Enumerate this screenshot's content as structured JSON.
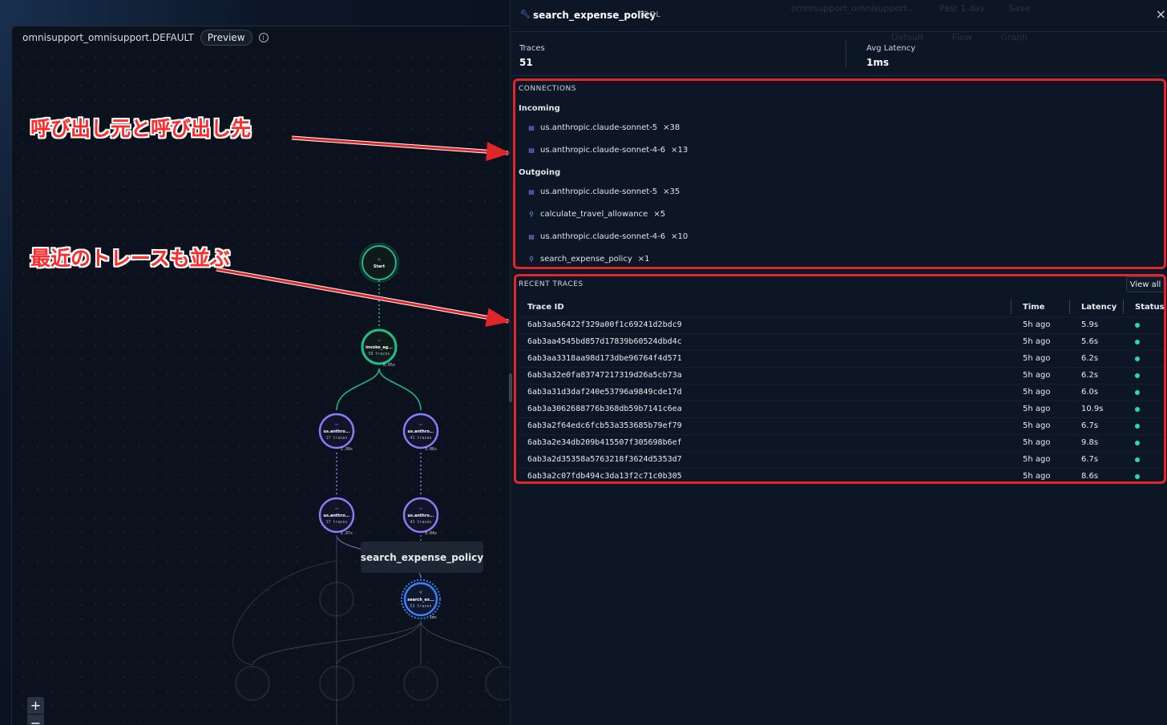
{
  "graph": {
    "title": "omnisupport_omnisupport.DEFAULT",
    "preview_label": "Preview",
    "nodes": {
      "start": "Start",
      "invoke": {
        "label": "invoke_ag...",
        "traces": "58 traces",
        "latency": "8.05s"
      },
      "l1a": {
        "label": "us.anthro...",
        "traces": "17 traces",
        "latency": "1.99s"
      },
      "l1b": {
        "label": "us.anthro...",
        "traces": "41 traces",
        "latency": "3.06s"
      },
      "l2a": {
        "label": "us.anthro...",
        "traces": "17 traces",
        "latency": "1.97s"
      },
      "l2b": {
        "label": "us.anthro...",
        "traces": "41 traces",
        "latency": "3.04s"
      },
      "search": {
        "label": "search_ex...",
        "traces": "51 traces",
        "latency": "1ms"
      }
    },
    "tooltip": "search_expense_policy",
    "zoom_in": "+",
    "zoom_out": "−"
  },
  "annotations": {
    "note1": "呼び出し元と呼び出し先",
    "note2": "最近のトレースも並ぶ"
  },
  "panel": {
    "title": "search_expense_policy",
    "badge": "TOOL",
    "close": "×",
    "ghost_top": [
      "omnisupport_omnisupport...",
      "Past 1 day",
      "Save"
    ],
    "ghost_bar": [
      "Default",
      "Flow",
      "Graph"
    ],
    "stats": {
      "traces_label": "Traces",
      "traces_value": "51",
      "latency_label": "Avg Latency",
      "latency_value": "1ms"
    },
    "connections": {
      "title": "CONNECTIONS",
      "incoming_label": "Incoming",
      "incoming": [
        {
          "name": "us.anthropic.claude-sonnet-5",
          "count": "×38",
          "icon": "model-icon"
        },
        {
          "name": "us.anthropic.claude-sonnet-4-6",
          "count": "×13",
          "icon": "model-icon"
        }
      ],
      "outgoing_label": "Outgoing",
      "outgoing": [
        {
          "name": "us.anthropic.claude-sonnet-5",
          "count": "×35",
          "icon": "model-icon"
        },
        {
          "name": "calculate_travel_allowance",
          "count": "×5",
          "icon": "wrench-icon"
        },
        {
          "name": "us.anthropic.claude-sonnet-4-6",
          "count": "×10",
          "icon": "model-icon"
        },
        {
          "name": "search_expense_policy",
          "count": "×1",
          "icon": "wrench-icon"
        }
      ]
    },
    "recent": {
      "title": "RECENT TRACES",
      "view_all": "View all",
      "columns": [
        "Trace ID",
        "Time",
        "Latency",
        "Status"
      ],
      "rows": [
        {
          "id": "6ab3aa56422f329a00f1c69241d2bdc9",
          "time": "5h ago",
          "latency": "5.9s"
        },
        {
          "id": "6ab3aa4545bd857d17839b60524dbd4c",
          "time": "5h ago",
          "latency": "5.6s"
        },
        {
          "id": "6ab3aa3318aa98d173dbe96764f4d571",
          "time": "5h ago",
          "latency": "6.2s"
        },
        {
          "id": "6ab3a32e0fa83747217319d26a5cb73a",
          "time": "5h ago",
          "latency": "6.2s"
        },
        {
          "id": "6ab3a31d3daf240e53796a9849cde17d",
          "time": "5h ago",
          "latency": "6.0s"
        },
        {
          "id": "6ab3a3062688776b368db59b7141c6ea",
          "time": "5h ago",
          "latency": "10.9s"
        },
        {
          "id": "6ab3a2f64edc6fcb53a353685b79ef79",
          "time": "5h ago",
          "latency": "6.7s"
        },
        {
          "id": "6ab3a2e34db209b415507f305698b6ef",
          "time": "5h ago",
          "latency": "9.8s"
        },
        {
          "id": "6ab3a2d35358a5763218f3624d5353d7",
          "time": "5h ago",
          "latency": "6.7s"
        },
        {
          "id": "6ab3a2c07fdb494c3da13f2c71c0b305",
          "time": "5h ago",
          "latency": "8.6s"
        }
      ],
      "status_color": "#2dd4bf"
    }
  }
}
